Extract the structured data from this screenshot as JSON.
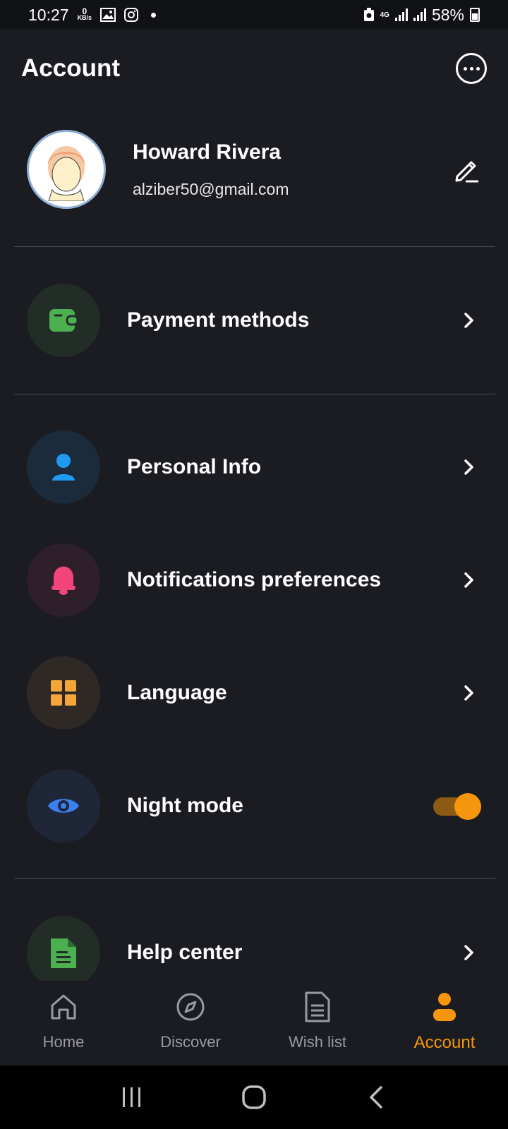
{
  "status_bar": {
    "time": "10:27",
    "kbs_value": "0",
    "kbs_unit": "KB/s",
    "network": "4G",
    "battery": "58%"
  },
  "header": {
    "title": "Account"
  },
  "profile": {
    "name": "Howard Rivera",
    "email": "alziber50@gmail.com"
  },
  "menu": {
    "payment": {
      "label": "Payment methods",
      "icon": "wallet-icon",
      "color": "#4caf50"
    },
    "personal": {
      "label": "Personal Info",
      "icon": "person-icon",
      "color": "#1e9bf0"
    },
    "notifications": {
      "label": "Notifications preferences",
      "icon": "bell-icon",
      "color": "#f2467a"
    },
    "language": {
      "label": "Language",
      "icon": "grid-icon",
      "color": "#f5a53a"
    },
    "night_mode": {
      "label": "Night mode",
      "icon": "eye-icon",
      "color": "#3b7ef0",
      "enabled": true
    },
    "help": {
      "label": "Help center",
      "icon": "document-icon",
      "color": "#4caf50"
    }
  },
  "bottom_nav": {
    "items": [
      {
        "label": "Home",
        "icon": "home-icon"
      },
      {
        "label": "Discover",
        "icon": "compass-icon"
      },
      {
        "label": "Wish list",
        "icon": "list-icon"
      },
      {
        "label": "Account",
        "icon": "user-icon",
        "active": true
      }
    ]
  },
  "colors": {
    "background": "#1b1c22",
    "accent": "#f5960d"
  }
}
